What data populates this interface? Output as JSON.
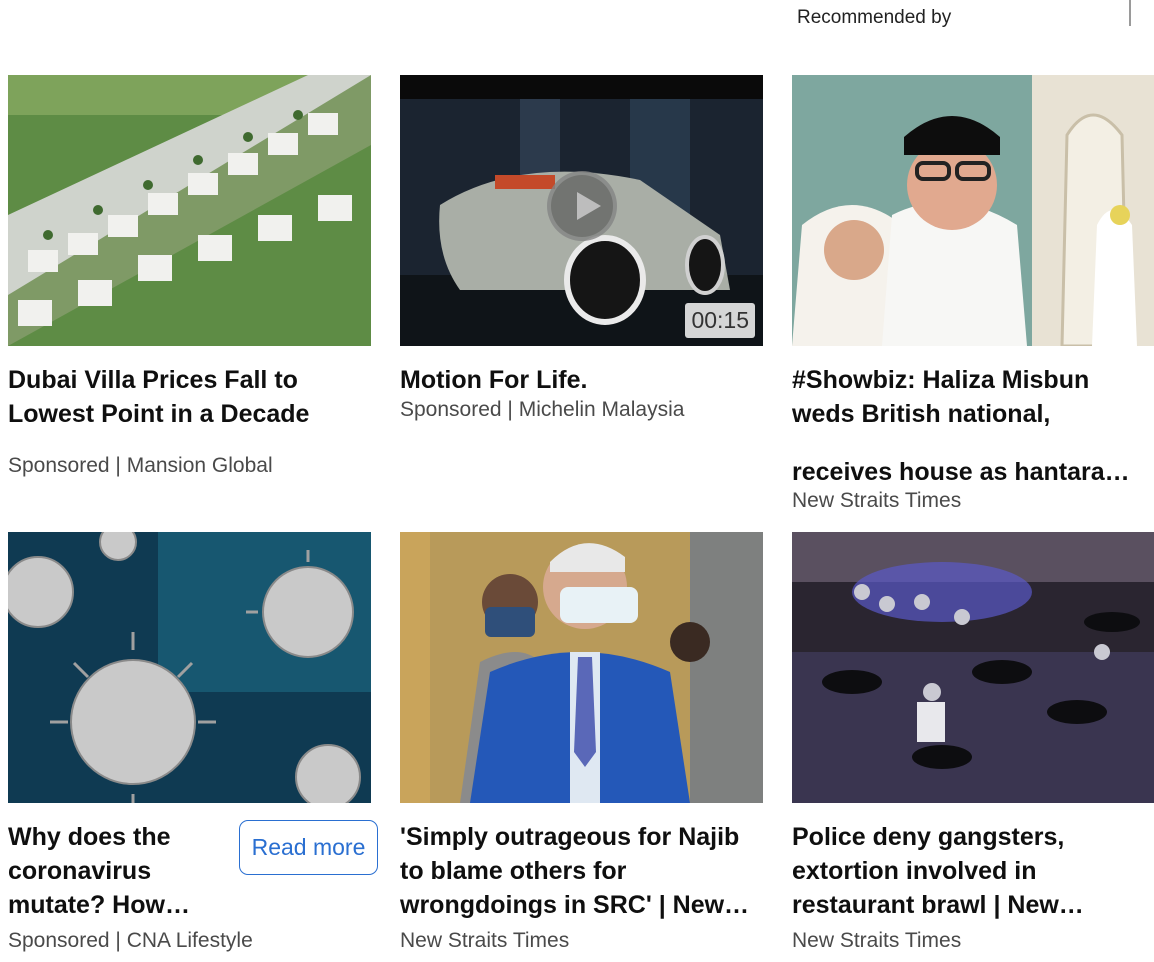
{
  "header": {
    "recommended_by": "Recommended by"
  },
  "cards": [
    {
      "title": "Dubai Villa Prices Fall to Lowest Point in a Decade",
      "source": "Sponsored | Mansion Global"
    },
    {
      "title": "Motion For Life.",
      "source": "Sponsored | Michelin Malaysia",
      "duration": "00:15"
    },
    {
      "title": "#Showbiz: Haliza Misbun weds British national,",
      "title_line3": "receives house as hantara…",
      "source": "New Straits Times"
    },
    {
      "title": "Why does the coronavirus mutate? How…",
      "source": "Sponsored | CNA Lifestyle",
      "cta": "Read more"
    },
    {
      "title": "'Simply outrageous for Najib to blame others for wrongdoings in SRC' | New…",
      "source": "New Straits Times"
    },
    {
      "title": "Police deny gangsters, extortion involved in restaurant brawl | New…",
      "source": "New Straits Times"
    }
  ]
}
